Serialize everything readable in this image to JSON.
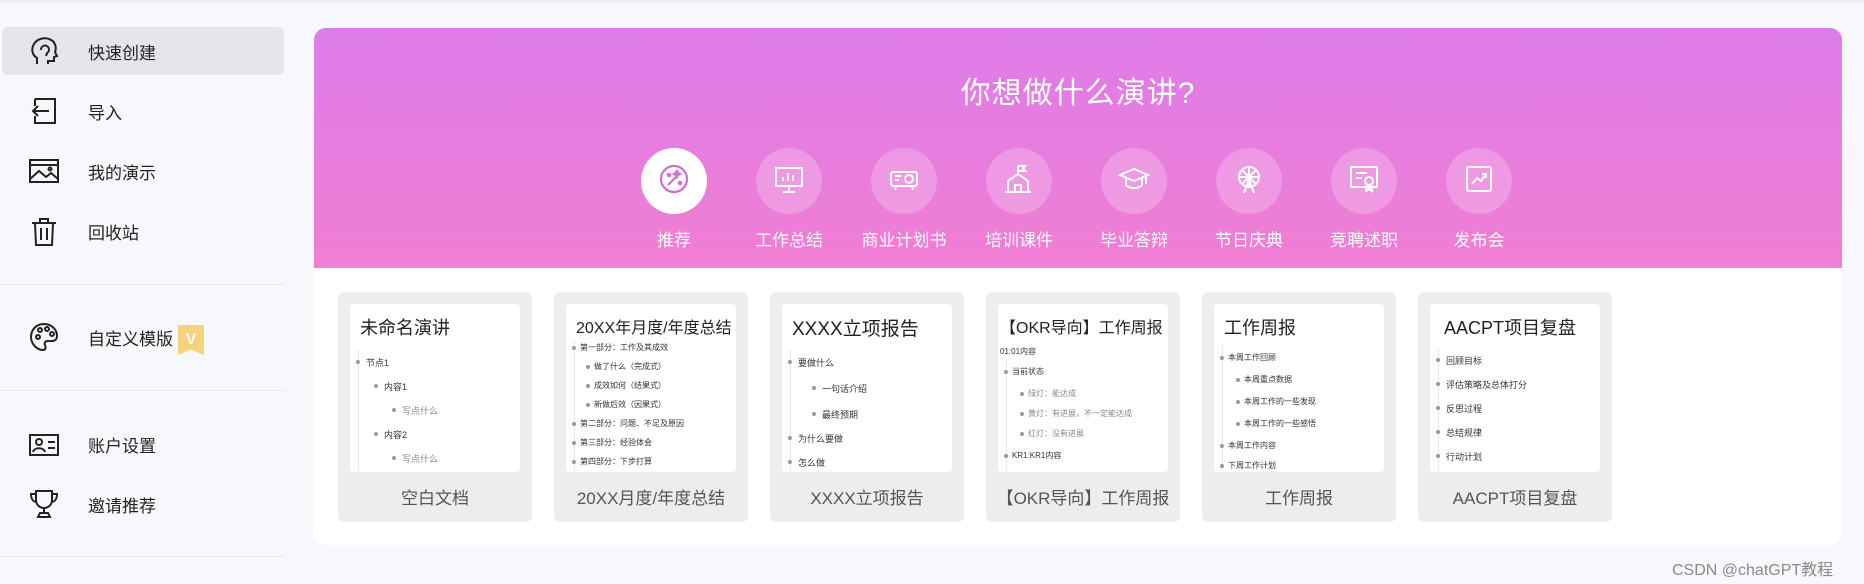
{
  "sidebar": {
    "items": [
      {
        "label": "快速创建",
        "icon": "quick-create-icon"
      },
      {
        "label": "导入",
        "icon": "import-icon"
      },
      {
        "label": "我的演示",
        "icon": "presentations-icon"
      },
      {
        "label": "回收站",
        "icon": "trash-icon"
      },
      {
        "label": "自定义模版",
        "icon": "palette-icon",
        "badge": "V"
      },
      {
        "label": "账户设置",
        "icon": "account-icon"
      },
      {
        "label": "邀请推荐",
        "icon": "trophy-icon"
      }
    ]
  },
  "hero": {
    "title": "你想做什么演讲?",
    "categories": [
      {
        "label": "推荐",
        "icon": "recommend-icon",
        "active": true
      },
      {
        "label": "工作总结",
        "icon": "chart-board-icon"
      },
      {
        "label": "商业计划书",
        "icon": "projector-icon"
      },
      {
        "label": "培训课件",
        "icon": "school-icon"
      },
      {
        "label": "毕业答辩",
        "icon": "graduation-cap-icon"
      },
      {
        "label": "节日庆典",
        "icon": "ferris-wheel-icon"
      },
      {
        "label": "竞聘述职",
        "icon": "certificate-icon"
      },
      {
        "label": "发布会",
        "icon": "trend-icon"
      }
    ]
  },
  "templates": [
    {
      "name": "空白文档",
      "thumb_title": "未命名演讲",
      "lines": [
        "节点1",
        "内容1",
        "写点什么",
        "内容2",
        "写点什么"
      ]
    },
    {
      "name": "20XX月度/年度总结",
      "thumb_title": "20XX年月度/年度总结",
      "lines": [
        "第一部分：工作及其成效",
        "做了什么（完成式）",
        "成效如何（结果式）",
        "新做后效（因果式）",
        "第二部分：问题、不足及原因",
        "第三部分：经验体会",
        "第四部分：下步打算"
      ]
    },
    {
      "name": "XXXX立项报告",
      "thumb_title": "XXXX立项报告",
      "lines": [
        "要做什么",
        "一句话介绍",
        "最终预期",
        "为什么要做",
        "怎么做"
      ]
    },
    {
      "name": "【OKR导向】工作周报",
      "thumb_title": "【OKR导向】工作周报",
      "lines": [
        "01:01内容",
        "当前状态",
        "绿灯：能达成",
        "黄灯：有进展，不一定能达成",
        "红灯：没有进展",
        "KR1:KR1内容"
      ]
    },
    {
      "name": "工作周报",
      "thumb_title": "工作周报",
      "lines": [
        "本周工作回顾",
        "本周重点数据",
        "本周工作的一些发现",
        "本周工作的一些感悟",
        "本周工作内容",
        "下周工作计划"
      ]
    },
    {
      "name": "AACPT项目复盘",
      "thumb_title": "AACPT项目复盘",
      "lines": [
        "回顾目标",
        "评估策略及总体打分",
        "反思过程",
        "总结规律",
        "行动计划"
      ]
    }
  ],
  "watermark": "CSDN @chatGPT教程",
  "colors": {
    "hero_top": "#de7cea",
    "hero_bottom": "#f07ed3",
    "active_nav": "#e3e5ea",
    "badge": "#f6d27a"
  }
}
